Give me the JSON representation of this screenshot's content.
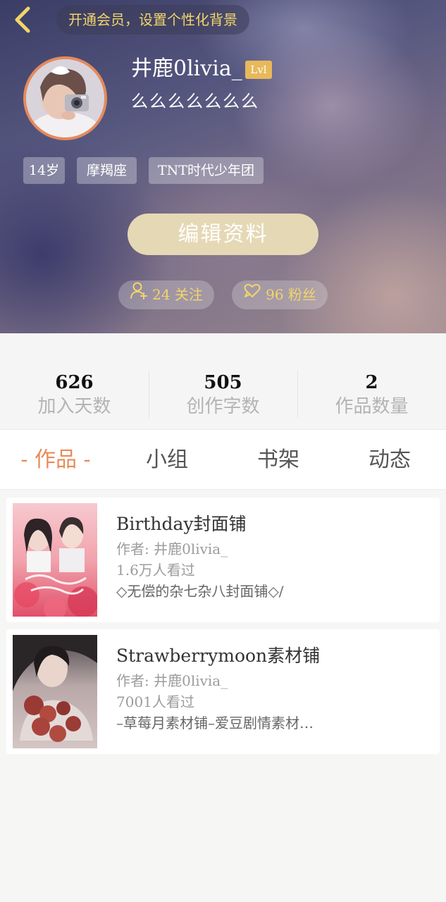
{
  "header": {
    "vip_banner": "开通会员，设置个性化背景",
    "username": "井鹿0livia_",
    "level": "Lvl",
    "signature": "么么么么么么么",
    "tags": [
      "14岁",
      "摩羯座",
      "TNT时代少年团"
    ],
    "edit_button": "编辑资料",
    "follow_label": "24 关注",
    "fans_label": "96 粉丝"
  },
  "stats": [
    {
      "value": "626",
      "label": "加入天数"
    },
    {
      "value": "505",
      "label": "创作字数"
    },
    {
      "value": "2",
      "label": "作品数量"
    }
  ],
  "tabs": [
    {
      "label": "- 作品 -",
      "active": true
    },
    {
      "label": "小组",
      "active": false
    },
    {
      "label": "书架",
      "active": false
    },
    {
      "label": "动态",
      "active": false
    }
  ],
  "works": [
    {
      "title": "Birthday封面铺",
      "author": "作者: 井鹿0livia_",
      "views": "1.6万人看过",
      "description": "◇无偿的杂七杂八封面铺◇/"
    },
    {
      "title": "Strawberrymoon素材铺",
      "author": "作者: 井鹿0livia_",
      "views": "7001人看过",
      "description": "–草莓月素材铺–爱豆剧情素材…"
    }
  ],
  "colors": {
    "accent": "#e98a58",
    "gold": "#f1d56a",
    "edit_button": "#e5d8b5",
    "avatar_ring": "#e48a5c"
  },
  "icons": [
    "back-arrow-icon",
    "person-plus-icon",
    "heart-chat-icon"
  ]
}
